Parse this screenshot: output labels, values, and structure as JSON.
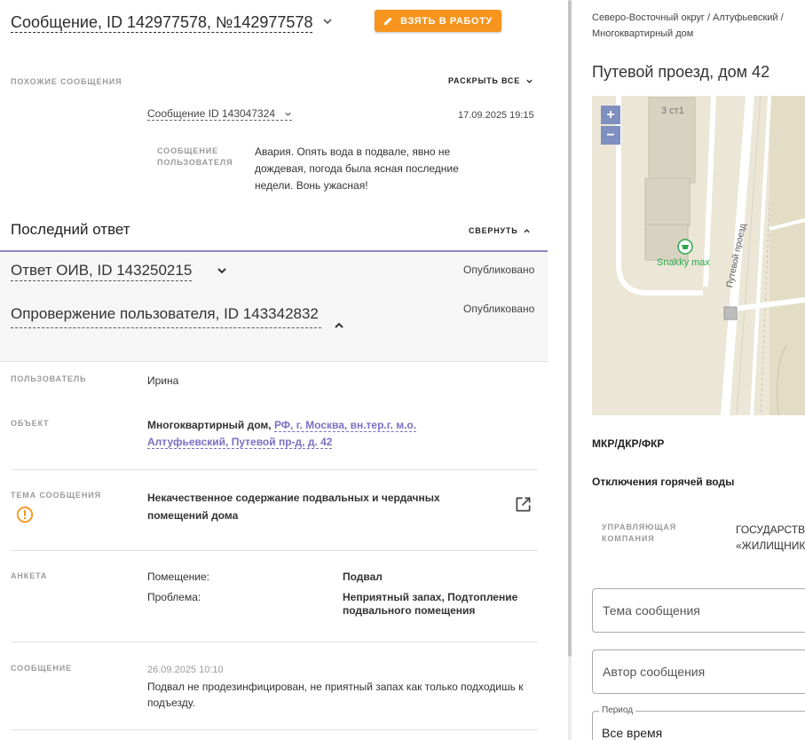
{
  "header": {
    "message_title": "Сообщение, ID 142977578, №142977578",
    "take_button": "ВЗЯТЬ В РАБОТУ"
  },
  "similar": {
    "label": "ПОХОЖИЕ СООБЩЕНИЯ",
    "expand_all": "РАСКРЫТЬ ВСЕ",
    "item_link": "Сообщение ID 143047324",
    "item_date": "17.09.2025 19:15",
    "user_msg_label": "СООБЩЕНИЕ ПОЛЬЗОВАТЕЛЯ",
    "user_msg_text": "Авария. Опять вода в подвале, явно не дождевая, погода была ясная последние недели. Вонь ужасная!"
  },
  "last_answer": {
    "title": "Последний ответ",
    "collapse": "СВЕРНУТЬ",
    "oiv_title": "Ответ ОИВ, ID 143250215",
    "oiv_status": "Опубликовано",
    "refute_title": "Опровержение пользователя, ID 143342832",
    "refute_status": "Опубликовано"
  },
  "details": {
    "user_label": "ПОЛЬЗОВАТЕЛЬ",
    "user_value": "Ирина",
    "object_label": "ОБЪЕКТ",
    "object_type": "Многоквартирный дом,",
    "object_address": "РФ, г. Москва, вн.тер.г. м.о. Алтуфьевский, Путевой пр-д, д. 42",
    "topic_label": "ТЕМА СООБЩЕНИЯ",
    "topic_value": "Некачественное содержание подвальных и чердачных помещений дома",
    "survey_label": "АНКЕТА",
    "survey_room_label": "Помещение:",
    "survey_room_value": "Подвал",
    "survey_problem_label": "Проблема:",
    "survey_problem_value": "Неприятный запах, Подтопление подвального помещения",
    "message_label": "СООБЩЕНИЕ",
    "message_date": "26.09.2025 10:10",
    "message_text": "Подвал не продезинфицирован, не приятный запах как только подходишь к подъезду."
  },
  "right": {
    "breadcrumb": "Северо-Восточный округ / Алтуфьевский / Многоквартирный дом",
    "address": "Путевой проезд, дом 42",
    "map": {
      "zoom_in": "+",
      "zoom_out": "−",
      "building_label": "3 ст1",
      "poi_label": "Snakky max",
      "street_label": "Путевой проезд"
    },
    "category": "МКР/ДКР/ФКР",
    "hot_water": "Отключения горячей воды",
    "uk_label": "УПРАВЛЯЮЩАЯ КОМПАНИЯ",
    "uk_value_line1": "ГОСУДАРСТВ",
    "uk_value_line2": "«ЖИЛИЩНИК",
    "topic_placeholder": "Тема сообщения",
    "author_placeholder": "Автор сообщения",
    "period_label": "Период",
    "period_value": "Все время"
  },
  "colors": {
    "accent_orange": "#f7941d",
    "link_purple": "#7b6fc4",
    "divider_purple": "#8c88c8",
    "warning_orange": "#f7941d"
  }
}
